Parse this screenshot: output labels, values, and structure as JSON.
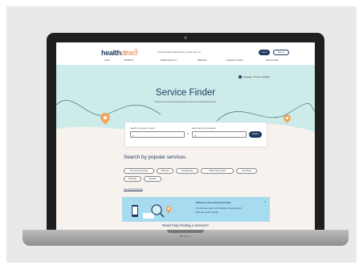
{
  "header": {
    "logo_main": "health",
    "logo_accent": "direct",
    "tagline": "Free Australian health advice you can count on",
    "login_label": "Log in",
    "signup_label": "Sign up",
    "nav": [
      "Home",
      "COVID-19",
      "Health topics A-Z",
      "Medicines",
      "Symptom checker",
      "Service finder"
    ]
  },
  "hero": {
    "language_link": "Language: Choose in English",
    "title": "Service Finder",
    "subtitle": "Search for and book an appointment with your local health services"
  },
  "search": {
    "service_label": "Search by service or name",
    "service_value": "",
    "location_label": "Enter suburb or postcode",
    "location_value": "",
    "in_label": "in",
    "button_label": "Search"
  },
  "popular": {
    "title": "Search by popular services",
    "chips": [
      "GP (General practice)",
      "Pharmacy",
      "Physiotherapy",
      "Child & family health",
      "Psychology",
      "Pathology",
      "Hospitals"
    ],
    "see_all": "See all service types"
  },
  "promo": {
    "title": "Welcome to the new Service Finder",
    "line1": "You can now search for hundreds of services and",
    "line2": "filter your search results"
  },
  "bottom_heading": "Need help finding a service?",
  "laptop_brand": "MacBook",
  "colors": {
    "navy": "#1e3a5f",
    "hero_teal": "#cdebe8",
    "accent_orange": "#e0783b",
    "pin_orange": "#f2a65a",
    "promo_blue": "#a7dbef"
  }
}
